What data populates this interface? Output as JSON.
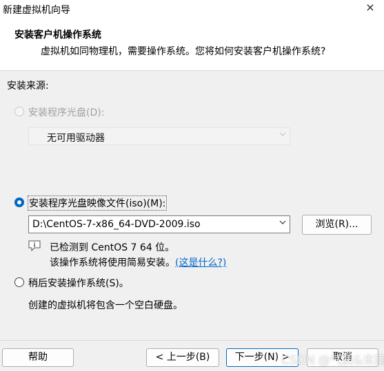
{
  "window": {
    "title": "新建虚拟机向导",
    "close_label": "×"
  },
  "header": {
    "title": "安装客户机操作系统",
    "subtitle": "虚拟机如同物理机，需要操作系统。您将如何安装客户机操作系统?"
  },
  "install_source_label": "安装来源:",
  "options": {
    "disc": {
      "label": "安装程序光盘(D):",
      "selected": false,
      "enabled": false,
      "drive_value": "无可用驱动器"
    },
    "iso": {
      "label": "安装程序光盘映像文件(iso)(M):",
      "selected": true,
      "enabled": true,
      "path_value": "D:\\CentOS-7-x86_64-DVD-2009.iso",
      "browse_label": "浏览(R)..."
    },
    "later": {
      "label": "稍后安装操作系统(S)。",
      "selected": false,
      "enabled": true
    }
  },
  "detection": {
    "line1": "已检测到 CentOS 7 64 位。",
    "line2": "该操作系统将使用简易安装。",
    "link": "(这是什么?)"
  },
  "later_note": "创建的虚拟机将包含一个空白硬盘。",
  "footer": {
    "help_label": "帮助",
    "back_label": "< 上一步(B)",
    "next_label": "下一步(N) >",
    "cancel_label": "取消"
  },
  "watermark": "CSDN @气质&末雨",
  "colors": {
    "accent": "#0067c0",
    "link": "#0066cc",
    "background": "#f0f0f0"
  },
  "icons": {
    "info": "info-icon",
    "dropdown": "chevron-down-icon"
  }
}
